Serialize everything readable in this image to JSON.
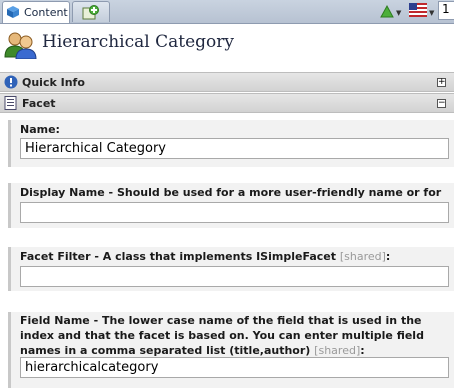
{
  "tabs": {
    "content_label": "Content",
    "language_number": "1"
  },
  "header": {
    "title": "Hierarchical Category"
  },
  "sections": {
    "quick_info": "Quick Info",
    "facet": "Facet"
  },
  "fields": {
    "name": {
      "label": "Name:",
      "value": "Hierarchical Category"
    },
    "display_name": {
      "label": "Display Name - Should be used for a more user-friendly name or for localization:",
      "value": ""
    },
    "facet_filter": {
      "label": "Facet Filter - A class that implements ISimpleFacet",
      "shared": "[shared]",
      "suffix": ":",
      "value": ""
    },
    "field_name": {
      "label": "Field Name - The lower case name of the field that is used in the index and that the facet is based on. You can enter multiple field names in a comma separated list (title,author)",
      "shared": "[shared]",
      "suffix": ":",
      "value": "hierarchicalcategory"
    }
  },
  "colors": {
    "tab_bar": "#c9d3e0",
    "section_bar": "#e0e0e0",
    "field_bg": "#f2f2f2"
  }
}
